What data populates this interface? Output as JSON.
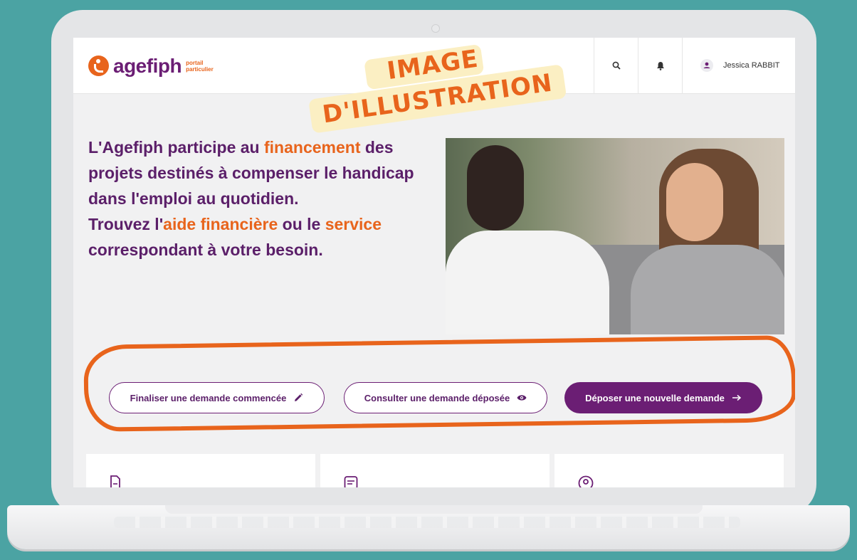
{
  "header": {
    "logo_text": "agefiph",
    "logo_sub_line1": "portail",
    "logo_sub_line2": "particulier",
    "user_name": "Jessica RABBIT"
  },
  "stamp": {
    "line1": "IMAGE",
    "line2": "D'ILLUSTRATION"
  },
  "hero": {
    "part1": "L'Agefiph participe au ",
    "part1_accent": "financement",
    "part2": " des projets destinés à compenser le handicap dans l'emploi au quotidien.",
    "part3": "Trouvez l'",
    "part3_accent": "aide financière",
    "part4": " ou le ",
    "part4_accent": "service",
    "part5": " correspondant à votre besoin."
  },
  "actions": {
    "finalize_label": "Finaliser une demande commencée",
    "consult_label": "Consulter une demande déposée",
    "new_label": "Déposer une nouvelle demande"
  },
  "colors": {
    "brand_purple": "#6b1e74",
    "accent_orange": "#e8641c",
    "background_teal": "#4ba3a3"
  },
  "icons": [
    "search-icon",
    "bell-icon",
    "user-icon",
    "pencil-icon",
    "eye-icon",
    "arrow-right-icon",
    "document-icon",
    "list-icon",
    "location-icon"
  ]
}
